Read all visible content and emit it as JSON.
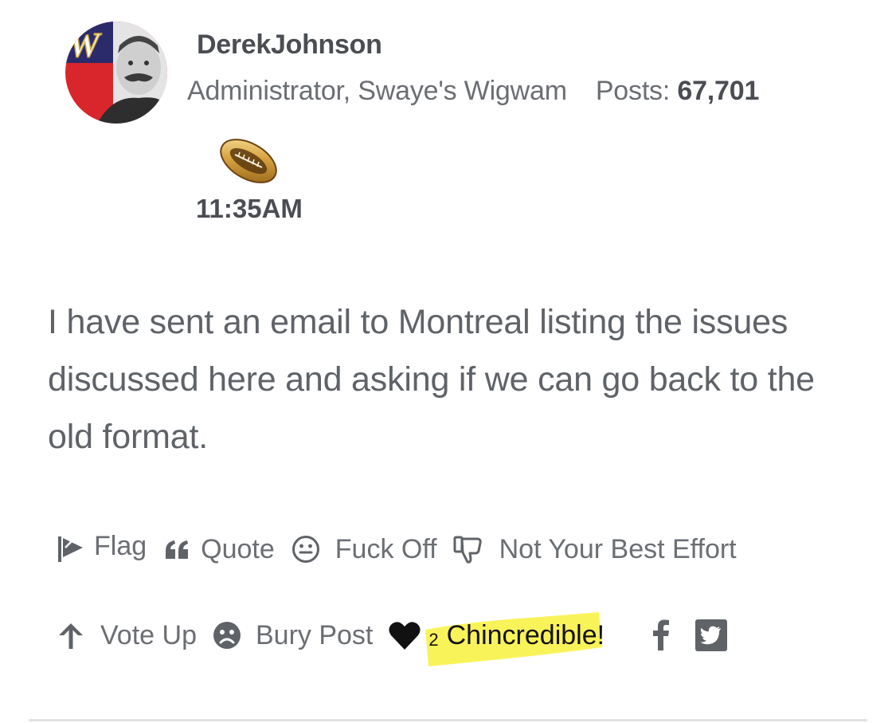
{
  "post": {
    "author": {
      "name": "DerekJohnson",
      "role": "Administrator, Swaye's Wigwam",
      "posts_label": "Posts:",
      "posts_count": "67,701",
      "avatar_letter": "W",
      "badge_icon": "football-icon"
    },
    "timestamp": "11:35AM",
    "body": "I have sent an email to Montreal listing the issues discussed here and asking if we can go back to the old format."
  },
  "actions": {
    "flag": "Flag",
    "quote": "Quote",
    "fuck_off": "Fuck Off",
    "not_best_effort": "Not Your Best Effort",
    "vote_up": "Vote Up",
    "bury_post": "Bury Post",
    "reaction_count": "2",
    "reaction_label": "Chincredible!"
  },
  "icons": {
    "flag": "flag-icon",
    "quote": "quote-icon",
    "fuck_off": "smiley-icon",
    "not_best_effort": "thumbs-down-icon",
    "vote_up": "arrow-up-icon",
    "bury_post": "sad-face-icon",
    "reaction": "heart-icon",
    "facebook": "facebook-icon",
    "twitter": "twitter-icon"
  },
  "colors": {
    "text": "#5f6368",
    "highlight": "#f9f24c",
    "heart": "#111111",
    "avatar_bg": "#d9262c"
  }
}
